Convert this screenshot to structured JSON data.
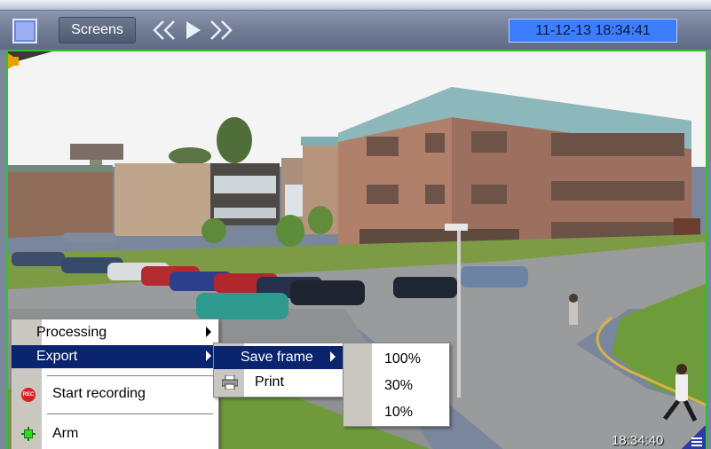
{
  "toolbar": {
    "screens_label": "Screens",
    "nav_prev_icon": "double-chevron-left-icon",
    "nav_play_icon": "play-icon",
    "nav_next_icon": "double-chevron-right-icon",
    "datetime": "11-12-13  18:34:41"
  },
  "video": {
    "overlay_time": "18:34:40",
    "speaker_icon": "speaker-icon",
    "corner_menu_icon": "menu-icon",
    "border_color": "#2fbf2f"
  },
  "context_menu": {
    "items": [
      {
        "label": "Processing",
        "has_submenu": true
      },
      {
        "label": "Export",
        "has_submenu": true,
        "selected": true
      },
      {
        "label": "Start recording",
        "icon": "rec-icon"
      },
      {
        "label": "Arm",
        "icon": "arm-icon"
      }
    ]
  },
  "export_menu": {
    "items": [
      {
        "label": "Save frame",
        "has_submenu": true,
        "selected": true
      },
      {
        "label": "Print",
        "icon": "printer-icon"
      }
    ]
  },
  "save_frame_menu": {
    "options": [
      "100%",
      "30%",
      "10%"
    ]
  },
  "rec_badge": "REC",
  "colors": {
    "menu_selected": "#0a2470",
    "clock_bg": "#3d7dff"
  }
}
